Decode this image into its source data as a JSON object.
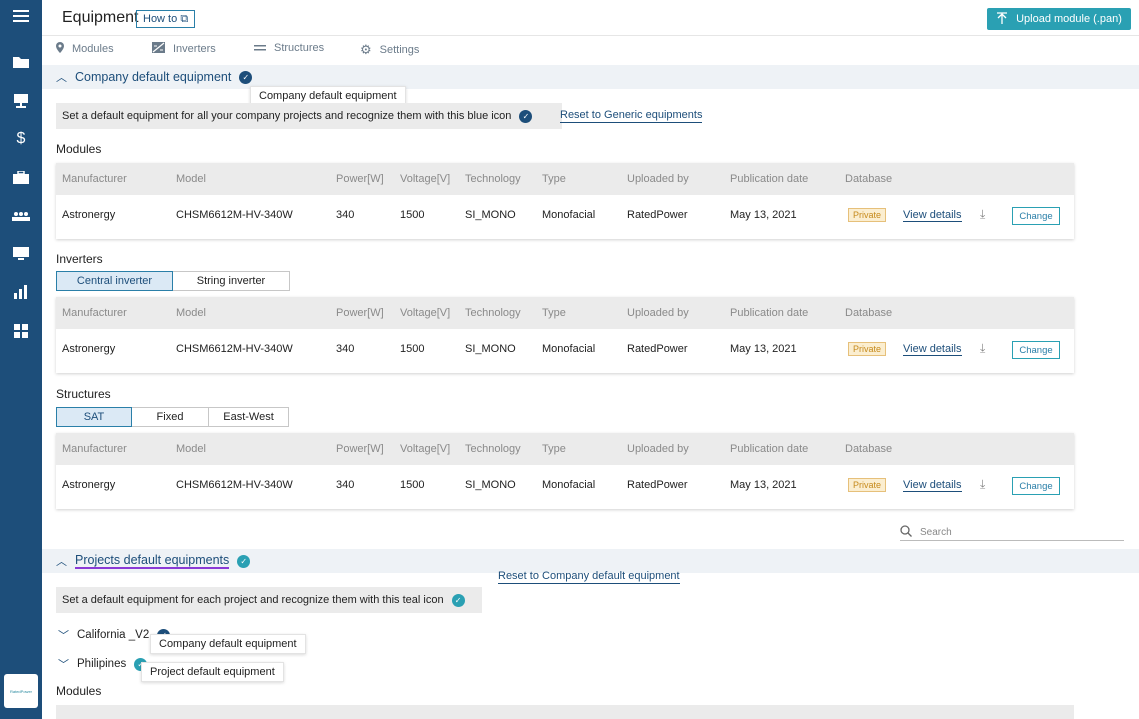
{
  "sidebar": {
    "items": [
      {
        "icon": "menu-icon"
      },
      {
        "icon": "folder-icon"
      },
      {
        "icon": "presentation-icon"
      },
      {
        "icon": "dollar-icon"
      },
      {
        "icon": "briefcase-icon"
      },
      {
        "icon": "users-icon"
      },
      {
        "icon": "monitor-icon"
      },
      {
        "icon": "bar-chart-icon"
      },
      {
        "icon": "grid-icon"
      }
    ],
    "logo_text": "RatedPower"
  },
  "header": {
    "title": "Equipment",
    "howto": "How to",
    "upload_button": "Upload module (.pan)"
  },
  "tabs": [
    {
      "label": "Modules",
      "icon": "pin-icon"
    },
    {
      "label": "Inverters",
      "icon": "inverter-icon"
    },
    {
      "label": "Structures",
      "icon": "equals-icon"
    },
    {
      "label": "Settings",
      "icon": "gear-icon"
    }
  ],
  "company": {
    "title": "Company default equipment",
    "tooltip": "Company default equipment",
    "info": "Set a default equipment for  all your company projects and recognize them with this blue icon",
    "reset_link": "Reset to Generic equipments",
    "modules_heading": "Modules",
    "inverters_heading": "Inverters",
    "structures_heading": "Structures",
    "inverter_toggle": [
      "Central inverter",
      "String inverter"
    ],
    "structure_toggle": [
      "SAT",
      "Fixed",
      "East-West"
    ]
  },
  "table": {
    "headers": [
      "Manufacturer",
      "Model",
      "Power[W]",
      "Voltage[V]",
      "Technology",
      "Type",
      "Uploaded by",
      "Publication date",
      "Database"
    ],
    "row": [
      "Astronergy",
      "CHSM6612M-HV-340W",
      "340",
      "1500",
      "SI_MONO",
      "Monofacial",
      "RatedPower",
      "May 13, 2021"
    ],
    "badge": "Private",
    "view_details": "View details",
    "change": "Change"
  },
  "search": {
    "placeholder": "Search"
  },
  "projects": {
    "title": "Projects default equipments",
    "reset_link": "Reset to Company default equipment",
    "info": "Set a default equipment for each project and recognize them with this teal icon",
    "items": [
      {
        "name": "California _V2",
        "tooltip": "Company default equipment"
      },
      {
        "name": "Philipines",
        "tooltip": "Project default equipment"
      }
    ],
    "modules_heading": "Modules"
  },
  "colors": {
    "primary": "#1d4e7a",
    "teal": "#2aa0b3",
    "badge": "#c68a1c"
  }
}
